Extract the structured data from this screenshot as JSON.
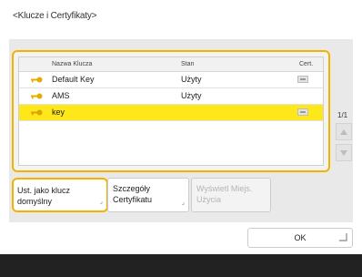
{
  "screen": {
    "title": "<Klucze i Certyfikaty>"
  },
  "list": {
    "columns": {
      "name": "Nazwa Klucza",
      "status": "Stan",
      "cert": "Cert."
    },
    "rows": [
      {
        "name": "Default Key",
        "status": "Użyty",
        "has_cert": true,
        "selected": false
      },
      {
        "name": "AMS",
        "status": "Użyty",
        "has_cert": false,
        "selected": false
      },
      {
        "name": "key",
        "status": "",
        "has_cert": true,
        "selected": true
      }
    ]
  },
  "pagination": {
    "indicator": "1/1"
  },
  "buttons": {
    "set_default": "Ust. jako klucz\ndomyślny",
    "cert_details": "Szczegóły\nCertyfikatu",
    "show_usage": "Wyświetl Miejs.\nUżycia",
    "ok": "OK"
  },
  "colors": {
    "accent": "#f2b300",
    "selected_row": "#ffe81a",
    "key_icon": "#e0b000"
  },
  "icons": {
    "key": "key-icon",
    "cert": "certificate-icon",
    "scroll_up": "arrow-up-icon",
    "scroll_down": "arrow-down-icon"
  }
}
